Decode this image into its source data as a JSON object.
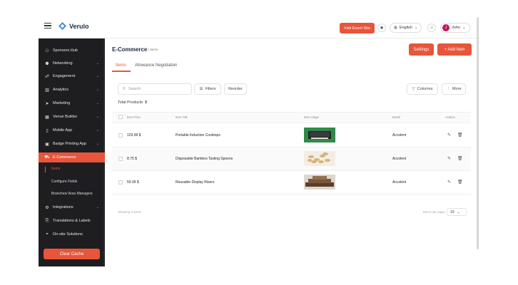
{
  "header": {
    "brand": "Verulo",
    "visit_event_site": "Visit Event Site",
    "language": "English",
    "user_initial": "J",
    "user_name": "John"
  },
  "sidebar": {
    "items": [
      {
        "label": "Sponsors Hub",
        "icon": "handshake-icon",
        "glyph": "⚇",
        "chevron": false
      },
      {
        "label": "Networking",
        "icon": "people-icon",
        "glyph": "⚉",
        "chevron": true
      },
      {
        "label": "Engagement",
        "icon": "megaphone-icon",
        "glyph": "☍",
        "chevron": true
      },
      {
        "label": "Analytics",
        "icon": "bar-chart-icon",
        "glyph": "▥",
        "chevron": true
      },
      {
        "label": "Marketing",
        "icon": "send-icon",
        "glyph": "➤",
        "chevron": true
      },
      {
        "label": "Venue Builder",
        "icon": "building-icon",
        "glyph": "▦",
        "chevron": true
      },
      {
        "label": "Mobile App",
        "icon": "mobile-icon",
        "glyph": "▯",
        "chevron": true
      },
      {
        "label": "Badge Printing App",
        "icon": "badge-icon",
        "glyph": "▣",
        "chevron": true
      },
      {
        "label": "E-Commerce",
        "icon": "cart-icon",
        "glyph": "⛟",
        "chevron": true,
        "active": true
      },
      {
        "label": "Integrations",
        "icon": "plug-icon",
        "glyph": "⚙",
        "chevron": true
      },
      {
        "label": "Translations & Labels",
        "icon": "translate-icon",
        "glyph": "⎘",
        "chevron": false
      },
      {
        "label": "On-site Solutions",
        "icon": "location-pin-icon",
        "glyph": "⌖",
        "chevron": false
      }
    ],
    "subitems": [
      "Items",
      "Configure Fields",
      "Branches/ Area Managers"
    ],
    "clear_cache": "Clear Cache"
  },
  "page": {
    "title": "E-Commerce",
    "crumb": "| Items",
    "settings": "Settings",
    "add_item": "+ Add Item",
    "tabs": [
      "Items",
      "Allowance Negotiation"
    ]
  },
  "toolbar": {
    "search_placeholder": "Search",
    "filters": "Filters",
    "reorder": "Reorder",
    "columns": "Columns",
    "more": "More"
  },
  "summary": {
    "total_label": "Total Products:",
    "total_value": "3"
  },
  "table": {
    "headers": [
      "Item Price",
      "Item Title",
      "Item Image",
      "Booth",
      "Actions"
    ],
    "rows": [
      {
        "price": "129.99 $",
        "title": "Portable Induction Cooktops",
        "image": "cooktop-image",
        "booth": "Accolent"
      },
      {
        "price": "8.75 $",
        "title": "Disposable Bamboo Tasting Spoons",
        "image": "spoons-image",
        "booth": "Accolent"
      },
      {
        "price": "59.99 $",
        "title": "Reusable Display Risers",
        "image": "risers-image",
        "booth": "Accolent"
      }
    ]
  },
  "footer": {
    "showing": "Showing 3 items",
    "per_page_label": "Items per page:",
    "per_page_value": "10"
  },
  "colors": {
    "accent": "#e8553a",
    "sidebar_bg": "#1e1e20",
    "brand_text": "#1e2a4a"
  }
}
